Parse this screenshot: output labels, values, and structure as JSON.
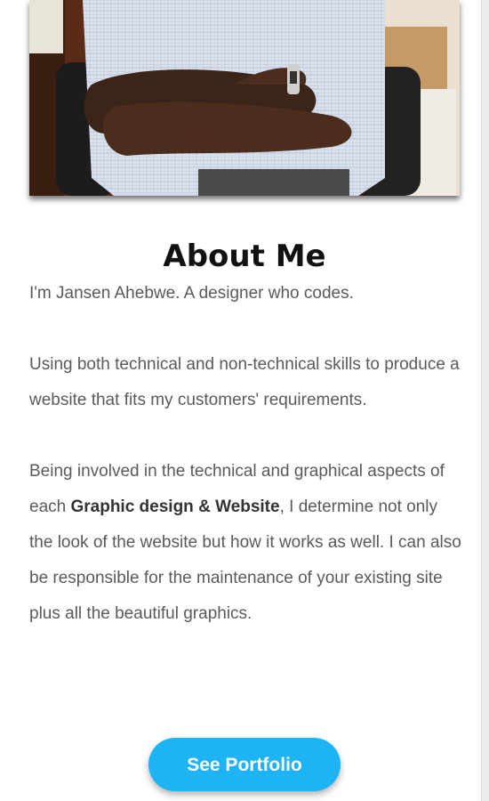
{
  "profile_photo": {
    "alt": "Photo of Jansen Ahebwe with arms crossed"
  },
  "about": {
    "heading": "About Me",
    "intro": "I'm Jansen Ahebwe. A designer who codes.",
    "paragraph2": "Using both technical and non-technical skills to produce a website that fits my customers' requirements.",
    "paragraph3_before": "Being involved in the technical and graphical aspects of each ",
    "paragraph3_bold": "Graphic design & Website",
    "paragraph3_after": ", I determine not only the look of the website but how it works as well. I can also be responsible for the maintenance of your existing site plus all the beautiful graphics."
  },
  "cta": {
    "label": "See Portfolio"
  },
  "colors": {
    "button": "#1eb3f5",
    "text": "#5a5a5a",
    "heading": "#111111"
  }
}
